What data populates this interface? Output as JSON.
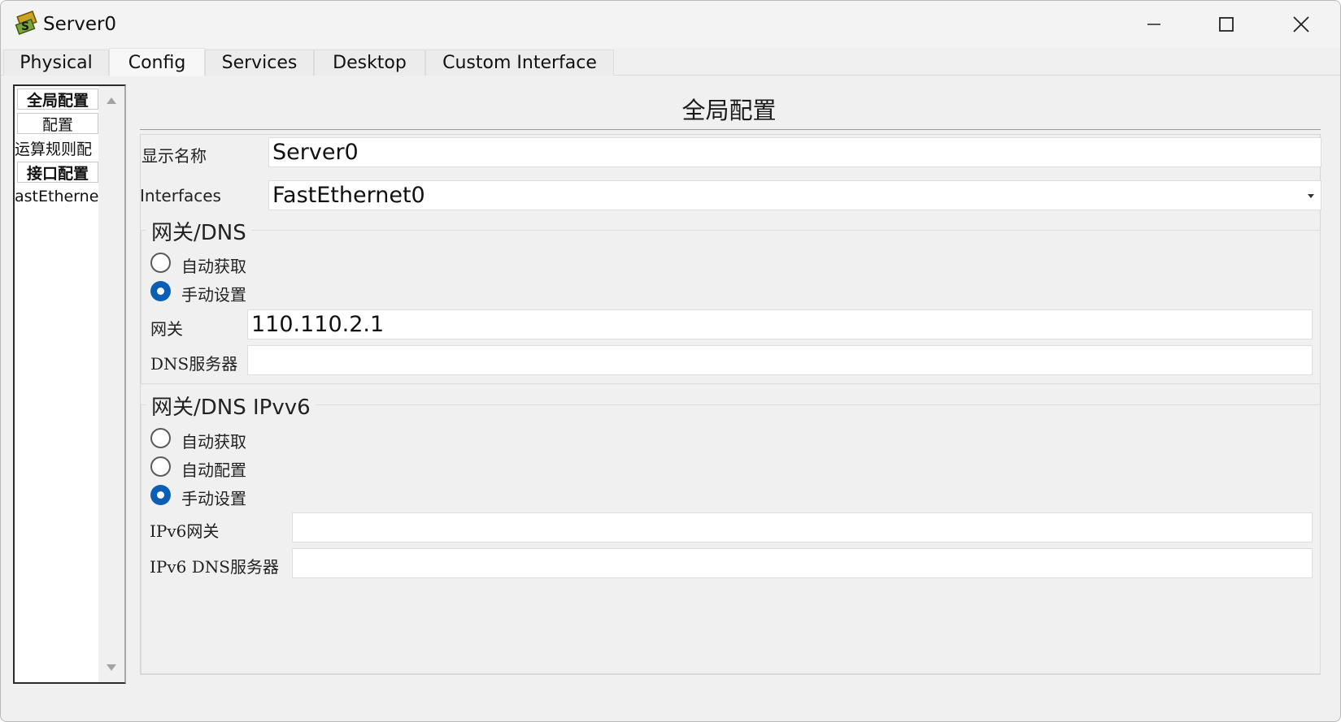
{
  "window": {
    "title": "Server0",
    "minimize_icon": "minimize-icon",
    "maximize_icon": "maximize-icon",
    "close_icon": "close-icon"
  },
  "tabs": [
    {
      "label": "Physical"
    },
    {
      "label": "Config",
      "active": true
    },
    {
      "label": "Services"
    },
    {
      "label": "Desktop"
    },
    {
      "label": "Custom Interface"
    }
  ],
  "sidebar": {
    "items": [
      {
        "label": "全局配置"
      },
      {
        "label": "配置"
      },
      {
        "label": "运算规则配"
      },
      {
        "label": "接口配置"
      },
      {
        "label": "astEtherne"
      }
    ]
  },
  "main": {
    "title": "全局配置",
    "display_name_label": "显示名称",
    "display_name_value": "Server0",
    "interfaces_label": "Interfaces",
    "interfaces_value": "FastEthernet0"
  },
  "gateway_dns": {
    "legend": "网关/DNS",
    "auto_label": "自动获取",
    "manual_label": "手动设置",
    "selected": "manual",
    "gateway_label": "网关",
    "gateway_value": "110.110.2.1",
    "dns_label": "DNS服务器",
    "dns_value": ""
  },
  "gateway_dns_ipv6": {
    "legend": "网关/DNS IPvv6",
    "auto_label": "自动获取",
    "autoconfig_label": "自动配置",
    "manual_label": "手动设置",
    "selected": "manual",
    "gateway_label": "IPv6网关",
    "gateway_value": "",
    "dns_label": "IPv6 DNS服务器",
    "dns_value": ""
  },
  "colors": {
    "radio_selected": "#0a5fb4",
    "window_bg": "#f0f0f0"
  }
}
